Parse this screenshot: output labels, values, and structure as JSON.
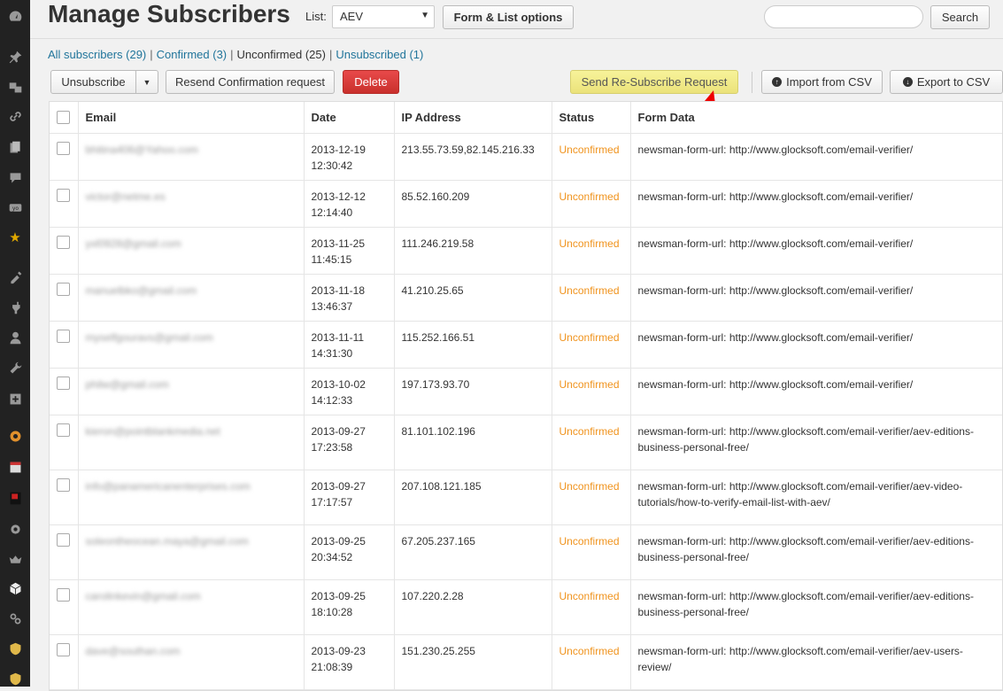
{
  "page": {
    "title": "Manage Subscribers"
  },
  "header": {
    "list_label": "List:",
    "list_value": "AEV",
    "form_list_button": "Form & List options",
    "search_placeholder": "",
    "search_button": "Search"
  },
  "filters": [
    {
      "label": "All subscribers (29)",
      "current": false
    },
    {
      "label": "Confirmed (3)",
      "current": false
    },
    {
      "label": "Unconfirmed (25)",
      "current": true
    },
    {
      "label": "Unsubscribed (1)",
      "current": false
    }
  ],
  "actions": {
    "unsubscribe": "Unsubscribe",
    "resend": "Resend Confirmation request",
    "delete": "Delete",
    "resubscribe": "Send Re-Subscribe Request",
    "import_csv": "Import from CSV",
    "export_csv": "Export to CSV"
  },
  "table": {
    "columns": [
      "Email",
      "Date",
      "IP Address",
      "Status",
      "Form Data"
    ],
    "rows": [
      {
        "email": "bhitina406@Yahoo.com",
        "date": "2013-12-19",
        "time": "12:30:42",
        "ip": "213.55.73.59,82.145.216.33",
        "status": "Unconfirmed",
        "form": "newsman-form-url: http://www.glocksoft.com/email-verifier/"
      },
      {
        "email": "victor@netme.es",
        "date": "2013-12-12",
        "time": "12:14:40",
        "ip": "85.52.160.209",
        "status": "Unconfirmed",
        "form": "newsman-form-url: http://www.glocksoft.com/email-verifier/"
      },
      {
        "email": "yxl0928@gmail.com",
        "date": "2013-11-25",
        "time": "11:45:15",
        "ip": "111.246.219.58",
        "status": "Unconfirmed",
        "form": "newsman-form-url: http://www.glocksoft.com/email-verifier/"
      },
      {
        "email": "manuelbko@gmail.com",
        "date": "2013-11-18",
        "time": "13:46:37",
        "ip": "41.210.25.65",
        "status": "Unconfirmed",
        "form": "newsman-form-url: http://www.glocksoft.com/email-verifier/"
      },
      {
        "email": "myselfgouravs@gmail.com",
        "date": "2013-11-11",
        "time": "14:31:30",
        "ip": "115.252.166.51",
        "status": "Unconfirmed",
        "form": "newsman-form-url: http://www.glocksoft.com/email-verifier/"
      },
      {
        "email": "philw@gmail.com",
        "date": "2013-10-02",
        "time": "14:12:33",
        "ip": "197.173.93.70",
        "status": "Unconfirmed",
        "form": "newsman-form-url: http://www.glocksoft.com/email-verifier/"
      },
      {
        "email": "kieron@pointblankmedia.net",
        "date": "2013-09-27",
        "time": "17:23:58",
        "ip": "81.101.102.196",
        "status": "Unconfirmed",
        "form": "newsman-form-url: http://www.glocksoft.com/email-verifier/aev-editions-business-personal-free/"
      },
      {
        "email": "info@panamericanenterprises.com",
        "date": "2013-09-27",
        "time": "17:17:57",
        "ip": "207.108.121.185",
        "status": "Unconfirmed",
        "form": "newsman-form-url: http://www.glocksoft.com/email-verifier/aev-video-tutorials/how-to-verify-email-list-with-aev/"
      },
      {
        "email": "soleontheocean.maya@gmail.com",
        "date": "2013-09-25",
        "time": "20:34:52",
        "ip": "67.205.237.165",
        "status": "Unconfirmed",
        "form": "newsman-form-url: http://www.glocksoft.com/email-verifier/aev-editions-business-personal-free/"
      },
      {
        "email": "carolinkevin@gmail.com",
        "date": "2013-09-25",
        "time": "18:10:28",
        "ip": "107.220.2.28",
        "status": "Unconfirmed",
        "form": "newsman-form-url: http://www.glocksoft.com/email-verifier/aev-editions-business-personal-free/"
      },
      {
        "email": "dave@southan.com",
        "date": "2013-09-23",
        "time": "21:08:39",
        "ip": "151.230.25.255",
        "status": "Unconfirmed",
        "form": "newsman-form-url: http://www.glocksoft.com/email-verifier/aev-users-review/"
      }
    ]
  },
  "sidebar": {
    "icons": [
      "dashboard-icon",
      "pin-icon",
      "media-icon",
      "link-icon",
      "pages-icon",
      "comments-icon",
      "seo-icon",
      "star-icon",
      "appearance-icon",
      "plugins-icon",
      "users-icon",
      "tools-icon",
      "settings-plus-icon",
      "plugin-orange-icon",
      "table-icon",
      "badge-icon",
      "gear-icon",
      "crown-icon",
      "cube-icon",
      "loop-icon",
      "shield-icon",
      "shield-small-icon"
    ]
  },
  "colors": {
    "status": "#f0931d",
    "link": "#21759b",
    "delete": "#d9534f",
    "resubscribe": "#f3ee8a"
  }
}
